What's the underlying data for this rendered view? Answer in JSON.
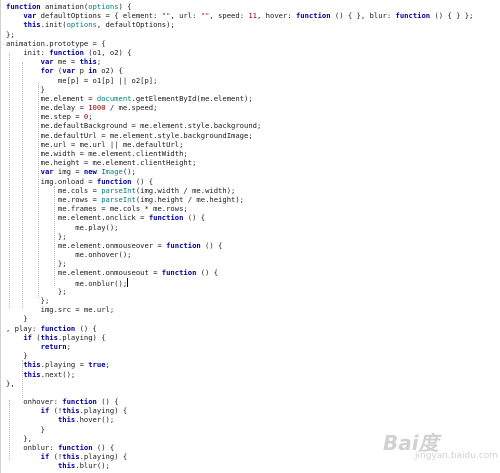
{
  "code": {
    "lines": [
      "function animation(options) {",
      "    var defaultOptions = { element: \"\", url: \"\", speed: 11, hover: function () { }, blur: function () { } };",
      "    this.init(options, defaultOptions);",
      "};",
      "animation.prototype = {",
      "    init: function (o1, o2) {",
      "        var me = this;",
      "        for (var p in o2) {",
      "            me[p] = o1[p] || o2[p];",
      "        }",
      "        me.element = document.getElementById(me.element);",
      "        me.delay = 1000 / me.speed;",
      "        me.step = 0;",
      "        me.defaultBackground = me.element.style.background;",
      "        me.defaultUrl = me.element.style.backgroundImage;",
      "        me.url = me.url || me.defaultUrl;",
      "        me.width = me.element.clientWidth;",
      "        me.height = me.element.clientHeight;",
      "        var img = new Image();",
      "        img.onload = function () {",
      "            me.cols = parseInt(img.width / me.width);",
      "            me.rows = parseInt(img.height / me.height);",
      "            me.frames = me.cols * me.rows;",
      "            me.element.onclick = function () {",
      "                me.play();",
      "            };",
      "            me.element.onmouseover = function () {",
      "                me.onhover();",
      "            };",
      "            me.element.onmouseout = function () {",
      "                me.onblur();",
      "            };",
      "        };",
      "        img.src = me.url;",
      "    }",
      ", play: function () {",
      "    if (this.playing) {",
      "        return;",
      "    }",
      "    this.playing = true;",
      "    this.next();",
      "},",
      "",
      "    onhover: function () {",
      "        if (!this.playing) {",
      "            this.hover();",
      "        }",
      "    },",
      "    onblur: function () {",
      "        if (!this.playing) {",
      "            this.blur();"
    ]
  },
  "watermark": {
    "logo_text": "Bai度",
    "sub_text": "jingyan.baidu.com"
  }
}
